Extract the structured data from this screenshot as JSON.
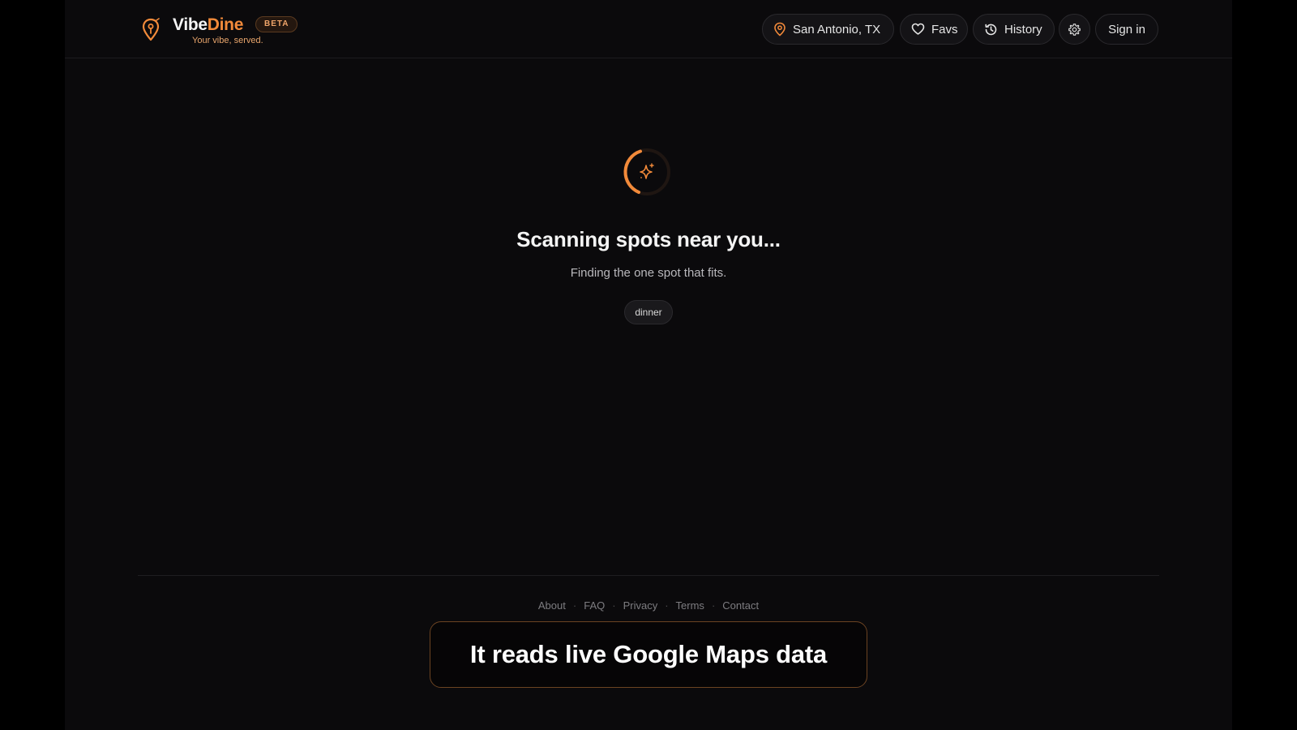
{
  "app": {
    "brand_part1": "Vibe",
    "brand_part2": "Dine",
    "badge": "BETA",
    "tagline": "Your vibe, served.",
    "accent_color": "#f28a3a"
  },
  "nav": {
    "location_label": "San Antonio, TX",
    "favs_label": "Favs",
    "history_label": "History",
    "signin_label": "Sign in",
    "icons": [
      "map-pin-icon",
      "heart-icon",
      "history-icon",
      "gear-icon"
    ]
  },
  "loading": {
    "title": "Scanning spots near you...",
    "subtitle": "Finding the one spot that fits.",
    "tag": "dinner",
    "icon": "sparkles-icon"
  },
  "footer": {
    "links": [
      "About",
      "FAQ",
      "Privacy",
      "Terms",
      "Contact"
    ],
    "separator": "·"
  },
  "caption": {
    "text": "It reads live Google Maps data"
  }
}
